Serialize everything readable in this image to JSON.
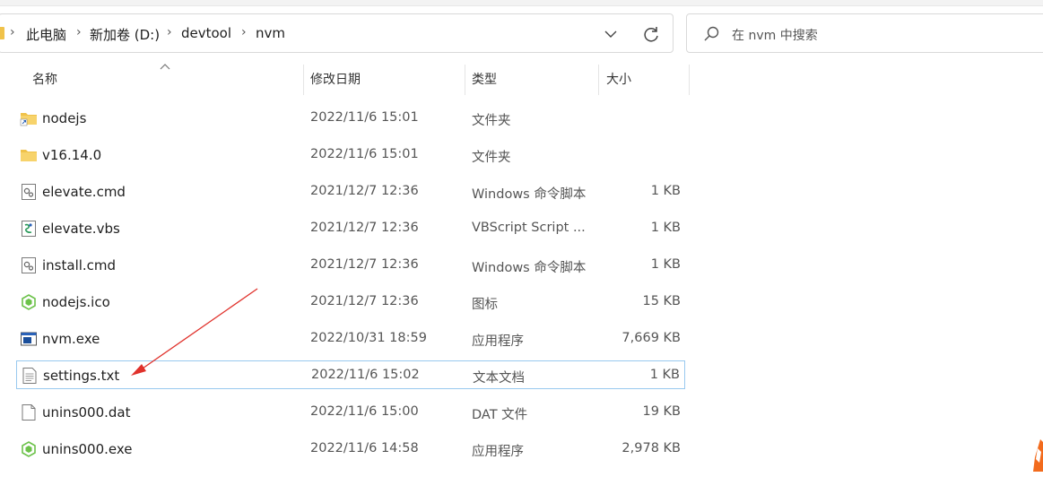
{
  "breadcrumb": [
    "此电脑",
    "新加卷 (D:)",
    "devtool",
    "nvm"
  ],
  "search": {
    "placeholder": "在 nvm 中搜索"
  },
  "columns": {
    "name": "名称",
    "date": "修改日期",
    "type": "类型",
    "size": "大小"
  },
  "files": [
    {
      "name": "nodejs",
      "date": "2022/11/6 15:01",
      "type": "文件夹",
      "size": "",
      "icon": "folder-shortcut-icon"
    },
    {
      "name": "v16.14.0",
      "date": "2022/11/6 15:01",
      "type": "文件夹",
      "size": "",
      "icon": "folder-icon"
    },
    {
      "name": "elevate.cmd",
      "date": "2021/12/7 12:36",
      "type": "Windows 命令脚本",
      "size": "1 KB",
      "icon": "cmd-file-icon"
    },
    {
      "name": "elevate.vbs",
      "date": "2021/12/7 12:36",
      "type": "VBScript Script ...",
      "size": "1 KB",
      "icon": "vbs-file-icon"
    },
    {
      "name": "install.cmd",
      "date": "2021/12/7 12:36",
      "type": "Windows 命令脚本",
      "size": "1 KB",
      "icon": "cmd-file-icon"
    },
    {
      "name": "nodejs.ico",
      "date": "2021/12/7 12:36",
      "type": "图标",
      "size": "15 KB",
      "icon": "nodejs-ico-icon"
    },
    {
      "name": "nvm.exe",
      "date": "2022/10/31 18:59",
      "type": "应用程序",
      "size": "7,669 KB",
      "icon": "exe-file-icon"
    },
    {
      "name": "settings.txt",
      "date": "2022/11/6 15:02",
      "type": "文本文档",
      "size": "1 KB",
      "icon": "txt-file-icon",
      "selected": true
    },
    {
      "name": "unins000.dat",
      "date": "2022/11/6 15:00",
      "type": "DAT 文件",
      "size": "19 KB",
      "icon": "blank-file-icon"
    },
    {
      "name": "unins000.exe",
      "date": "2022/11/6 14:58",
      "type": "应用程序",
      "size": "2,978 KB",
      "icon": "uninstaller-icon"
    }
  ],
  "colors": {
    "folder": "#f0c24a",
    "selection_border": "#99c9ef",
    "annotation_arrow": "#e0312b"
  }
}
